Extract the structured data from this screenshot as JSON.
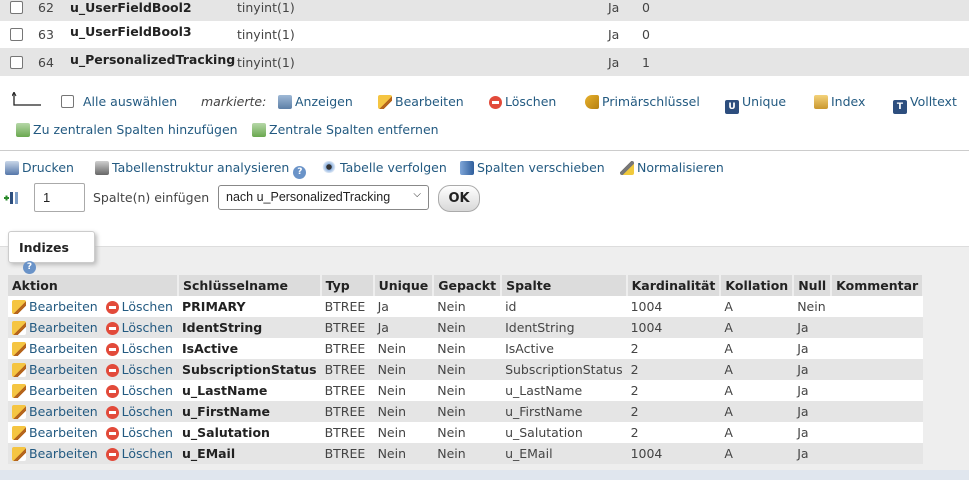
{
  "structure_rows": [
    {
      "num": "62",
      "name": "u_UserFieldBool2",
      "type": "tinyint(1)",
      "null": "Ja",
      "default": "0"
    },
    {
      "num": "63",
      "name": "u_UserFieldBool3",
      "type": "tinyint(1)",
      "null": "Ja",
      "default": "0"
    },
    {
      "num": "64",
      "name": "u_PersonalizedTracking",
      "type": "tinyint(1)",
      "null": "Ja",
      "default": "1"
    }
  ],
  "bulk": {
    "select_all": "Alle auswählen",
    "marked": "markierte:",
    "show": "Anzeigen",
    "edit": "Bearbeiten",
    "delete": "Löschen",
    "primary": "Primärschlüssel",
    "unique": "Unique",
    "index": "Index",
    "fulltext": "Volltext",
    "add_central": "Zu zentralen Spalten hinzufügen",
    "remove_central": "Zentrale Spalten entfernen"
  },
  "tools": {
    "print": "Drucken",
    "analyze": "Tabellenstruktur analysieren",
    "track": "Tabelle verfolgen",
    "move": "Spalten verschieben",
    "normalize": "Normalisieren"
  },
  "insert": {
    "count": "1",
    "label": "Spalte(n) einfügen",
    "position": "nach u_PersonalizedTracking",
    "ok": "OK"
  },
  "indexes": {
    "legend": "Indizes",
    "headers": [
      "Aktion",
      "Schlüsselname",
      "Typ",
      "Unique",
      "Gepackt",
      "Spalte",
      "Kardinalität",
      "Kollation",
      "Null",
      "Kommentar"
    ],
    "edit_label": "Bearbeiten",
    "delete_label": "Löschen",
    "rows": [
      {
        "name": "PRIMARY",
        "type": "BTREE",
        "unique": "Ja",
        "packed": "Nein",
        "column": "id",
        "cardinality": "1004",
        "collation": "A",
        "null": "Nein",
        "comment": ""
      },
      {
        "name": "IdentString",
        "type": "BTREE",
        "unique": "Ja",
        "packed": "Nein",
        "column": "IdentString",
        "cardinality": "1004",
        "collation": "A",
        "null": "Ja",
        "comment": ""
      },
      {
        "name": "IsActive",
        "type": "BTREE",
        "unique": "Nein",
        "packed": "Nein",
        "column": "IsActive",
        "cardinality": "2",
        "collation": "A",
        "null": "Ja",
        "comment": ""
      },
      {
        "name": "SubscriptionStatus",
        "type": "BTREE",
        "unique": "Nein",
        "packed": "Nein",
        "column": "SubscriptionStatus",
        "cardinality": "2",
        "collation": "A",
        "null": "Ja",
        "comment": ""
      },
      {
        "name": "u_LastName",
        "type": "BTREE",
        "unique": "Nein",
        "packed": "Nein",
        "column": "u_LastName",
        "cardinality": "2",
        "collation": "A",
        "null": "Ja",
        "comment": ""
      },
      {
        "name": "u_FirstName",
        "type": "BTREE",
        "unique": "Nein",
        "packed": "Nein",
        "column": "u_FirstName",
        "cardinality": "2",
        "collation": "A",
        "null": "Ja",
        "comment": ""
      },
      {
        "name": "u_Salutation",
        "type": "BTREE",
        "unique": "Nein",
        "packed": "Nein",
        "column": "u_Salutation",
        "cardinality": "2",
        "collation": "A",
        "null": "Ja",
        "comment": ""
      },
      {
        "name": "u_EMail",
        "type": "BTREE",
        "unique": "Nein",
        "packed": "Nein",
        "column": "u_EMail",
        "cardinality": "1004",
        "collation": "A",
        "null": "Ja",
        "comment": ""
      }
    ]
  },
  "icons": [
    "checkbox",
    "arrow-up-left-icon",
    "table-icon",
    "pencil-icon",
    "delete-icon",
    "key-icon",
    "unique-icon",
    "index-icon",
    "fulltext-icon",
    "central-columns-icon",
    "print-icon",
    "analyze-icon",
    "help-icon",
    "eye-icon",
    "move-columns-icon",
    "normalize-icon",
    "insert-column-icon"
  ]
}
